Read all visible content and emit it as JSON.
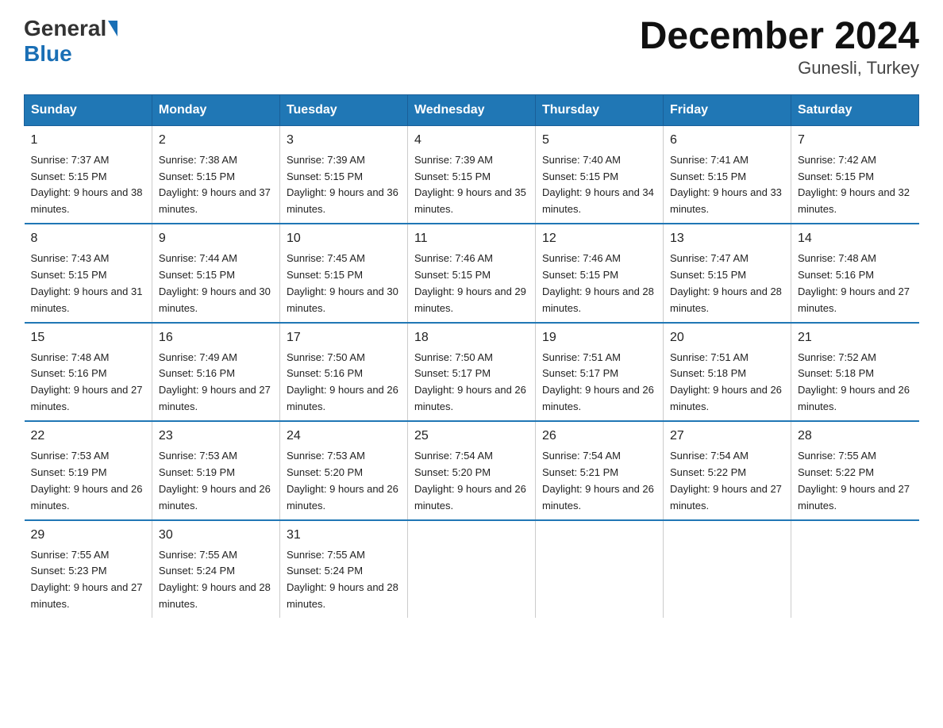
{
  "header": {
    "logo_general": "General",
    "logo_blue": "Blue",
    "title": "December 2024",
    "subtitle": "Gunesli, Turkey"
  },
  "calendar": {
    "days_of_week": [
      "Sunday",
      "Monday",
      "Tuesday",
      "Wednesday",
      "Thursday",
      "Friday",
      "Saturday"
    ],
    "weeks": [
      [
        {
          "day": "1",
          "sunrise": "7:37 AM",
          "sunset": "5:15 PM",
          "daylight": "9 hours and 38 minutes."
        },
        {
          "day": "2",
          "sunrise": "7:38 AM",
          "sunset": "5:15 PM",
          "daylight": "9 hours and 37 minutes."
        },
        {
          "day": "3",
          "sunrise": "7:39 AM",
          "sunset": "5:15 PM",
          "daylight": "9 hours and 36 minutes."
        },
        {
          "day": "4",
          "sunrise": "7:39 AM",
          "sunset": "5:15 PM",
          "daylight": "9 hours and 35 minutes."
        },
        {
          "day": "5",
          "sunrise": "7:40 AM",
          "sunset": "5:15 PM",
          "daylight": "9 hours and 34 minutes."
        },
        {
          "day": "6",
          "sunrise": "7:41 AM",
          "sunset": "5:15 PM",
          "daylight": "9 hours and 33 minutes."
        },
        {
          "day": "7",
          "sunrise": "7:42 AM",
          "sunset": "5:15 PM",
          "daylight": "9 hours and 32 minutes."
        }
      ],
      [
        {
          "day": "8",
          "sunrise": "7:43 AM",
          "sunset": "5:15 PM",
          "daylight": "9 hours and 31 minutes."
        },
        {
          "day": "9",
          "sunrise": "7:44 AM",
          "sunset": "5:15 PM",
          "daylight": "9 hours and 30 minutes."
        },
        {
          "day": "10",
          "sunrise": "7:45 AM",
          "sunset": "5:15 PM",
          "daylight": "9 hours and 30 minutes."
        },
        {
          "day": "11",
          "sunrise": "7:46 AM",
          "sunset": "5:15 PM",
          "daylight": "9 hours and 29 minutes."
        },
        {
          "day": "12",
          "sunrise": "7:46 AM",
          "sunset": "5:15 PM",
          "daylight": "9 hours and 28 minutes."
        },
        {
          "day": "13",
          "sunrise": "7:47 AM",
          "sunset": "5:15 PM",
          "daylight": "9 hours and 28 minutes."
        },
        {
          "day": "14",
          "sunrise": "7:48 AM",
          "sunset": "5:16 PM",
          "daylight": "9 hours and 27 minutes."
        }
      ],
      [
        {
          "day": "15",
          "sunrise": "7:48 AM",
          "sunset": "5:16 PM",
          "daylight": "9 hours and 27 minutes."
        },
        {
          "day": "16",
          "sunrise": "7:49 AM",
          "sunset": "5:16 PM",
          "daylight": "9 hours and 27 minutes."
        },
        {
          "day": "17",
          "sunrise": "7:50 AM",
          "sunset": "5:16 PM",
          "daylight": "9 hours and 26 minutes."
        },
        {
          "day": "18",
          "sunrise": "7:50 AM",
          "sunset": "5:17 PM",
          "daylight": "9 hours and 26 minutes."
        },
        {
          "day": "19",
          "sunrise": "7:51 AM",
          "sunset": "5:17 PM",
          "daylight": "9 hours and 26 minutes."
        },
        {
          "day": "20",
          "sunrise": "7:51 AM",
          "sunset": "5:18 PM",
          "daylight": "9 hours and 26 minutes."
        },
        {
          "day": "21",
          "sunrise": "7:52 AM",
          "sunset": "5:18 PM",
          "daylight": "9 hours and 26 minutes."
        }
      ],
      [
        {
          "day": "22",
          "sunrise": "7:53 AM",
          "sunset": "5:19 PM",
          "daylight": "9 hours and 26 minutes."
        },
        {
          "day": "23",
          "sunrise": "7:53 AM",
          "sunset": "5:19 PM",
          "daylight": "9 hours and 26 minutes."
        },
        {
          "day": "24",
          "sunrise": "7:53 AM",
          "sunset": "5:20 PM",
          "daylight": "9 hours and 26 minutes."
        },
        {
          "day": "25",
          "sunrise": "7:54 AM",
          "sunset": "5:20 PM",
          "daylight": "9 hours and 26 minutes."
        },
        {
          "day": "26",
          "sunrise": "7:54 AM",
          "sunset": "5:21 PM",
          "daylight": "9 hours and 26 minutes."
        },
        {
          "day": "27",
          "sunrise": "7:54 AM",
          "sunset": "5:22 PM",
          "daylight": "9 hours and 27 minutes."
        },
        {
          "day": "28",
          "sunrise": "7:55 AM",
          "sunset": "5:22 PM",
          "daylight": "9 hours and 27 minutes."
        }
      ],
      [
        {
          "day": "29",
          "sunrise": "7:55 AM",
          "sunset": "5:23 PM",
          "daylight": "9 hours and 27 minutes."
        },
        {
          "day": "30",
          "sunrise": "7:55 AM",
          "sunset": "5:24 PM",
          "daylight": "9 hours and 28 minutes."
        },
        {
          "day": "31",
          "sunrise": "7:55 AM",
          "sunset": "5:24 PM",
          "daylight": "9 hours and 28 minutes."
        },
        null,
        null,
        null,
        null
      ]
    ]
  }
}
